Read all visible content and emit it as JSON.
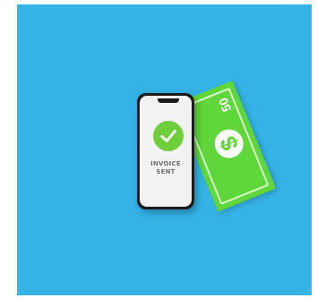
{
  "scene": {
    "background_color": "#35b3e6"
  },
  "phone": {
    "status_line_1": "INVOICE",
    "status_line_2": "SENT",
    "check_color": "#6fcf3b",
    "icon": "check-circle-icon"
  },
  "banknote": {
    "amount": "50",
    "symbol": "$",
    "color": "#5fd63a"
  }
}
